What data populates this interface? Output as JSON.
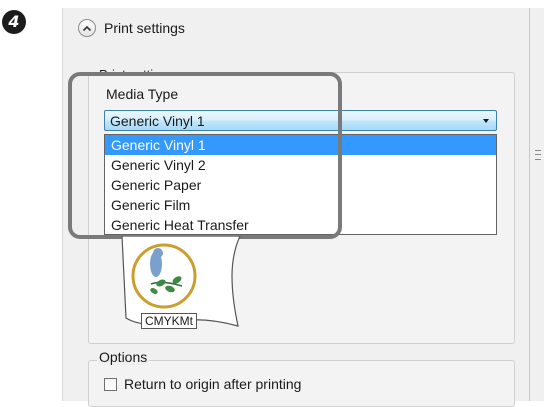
{
  "step": {
    "number": "4"
  },
  "section": {
    "title": "Print settings",
    "chevron_icon": "chevron-up-icon"
  },
  "print_settings_group": {
    "label": "Print settings"
  },
  "media_type": {
    "label": "Media Type",
    "selected": "Generic Vinyl 1",
    "options": [
      "Generic Vinyl 1",
      "Generic Vinyl 2",
      "Generic Paper",
      "Generic Film",
      "Generic Heat Transfer"
    ]
  },
  "preview": {
    "ink_label": "CMYKMt"
  },
  "options_group": {
    "label": "Options",
    "return_to_origin": {
      "label": "Return to origin after printing",
      "checked": false
    }
  },
  "colors": {
    "selection": "#3399ff",
    "dropdown_border": "#3c7fb1",
    "callout": "#7a7a7a"
  }
}
